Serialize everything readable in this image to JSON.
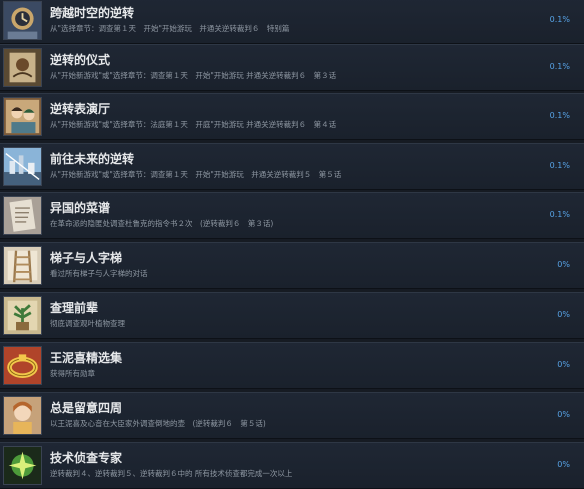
{
  "achievements": [
    {
      "title": "跨越时空的逆转",
      "desc": "从\"选择章节：调查第１天　开始\"开始游玩　并通关逆转裁判６　特别篇",
      "percent": "0.1%",
      "icon": "clock-portrait-icon"
    },
    {
      "title": "逆转的仪式",
      "desc": "从\"开始新游戏\"或\"选择章节：调查第１天　开始\"开始游玩 并通关逆转裁判６　第３话",
      "percent": "0.1%",
      "icon": "ritual-art-icon"
    },
    {
      "title": "逆转表演厅",
      "desc": "从\"开始新游戏\"或\"选择章节：法庭第１天　开庭\"开始游玩 并通关逆转裁判６　第４话",
      "percent": "0.1%",
      "icon": "theater-characters-icon"
    },
    {
      "title": "前往未来的逆转",
      "desc": "从\"开始新游戏\"或\"选择章节：调查第１天　开始\"开始游玩　并通关逆转裁判５　第５话",
      "percent": "0.1%",
      "icon": "future-city-icon"
    },
    {
      "title": "异国的菜谱",
      "desc": "在革命派的隐匿处调查杜鲁克的指令书２次　(逆转裁判６　第３话)",
      "percent": "0.1%",
      "icon": "recipe-paper-icon"
    },
    {
      "title": "梯子与人字梯",
      "desc": "看过所有梯子与人字梯的对话",
      "percent": "0%",
      "icon": "ladder-icon"
    },
    {
      "title": "查理前辈",
      "desc": "彻底调查观叶植物查理",
      "percent": "0%",
      "icon": "plant-charley-icon"
    },
    {
      "title": "王泥喜精选集",
      "desc": "获得所有勋章",
      "percent": "0%",
      "icon": "bracelet-icon"
    },
    {
      "title": "总是留意四周",
      "desc": "以王泥喜及心音在大臣家外调查倒地的壶　(逆转裁判６　第５话)",
      "percent": "0%",
      "icon": "girl-character-icon"
    },
    {
      "title": "技术侦查专家",
      "desc": "逆转裁判４、逆转裁判５、逆转裁判６中的 所有技术侦查都完成一次以上",
      "percent": "0%",
      "icon": "sparkle-badge-icon"
    }
  ]
}
